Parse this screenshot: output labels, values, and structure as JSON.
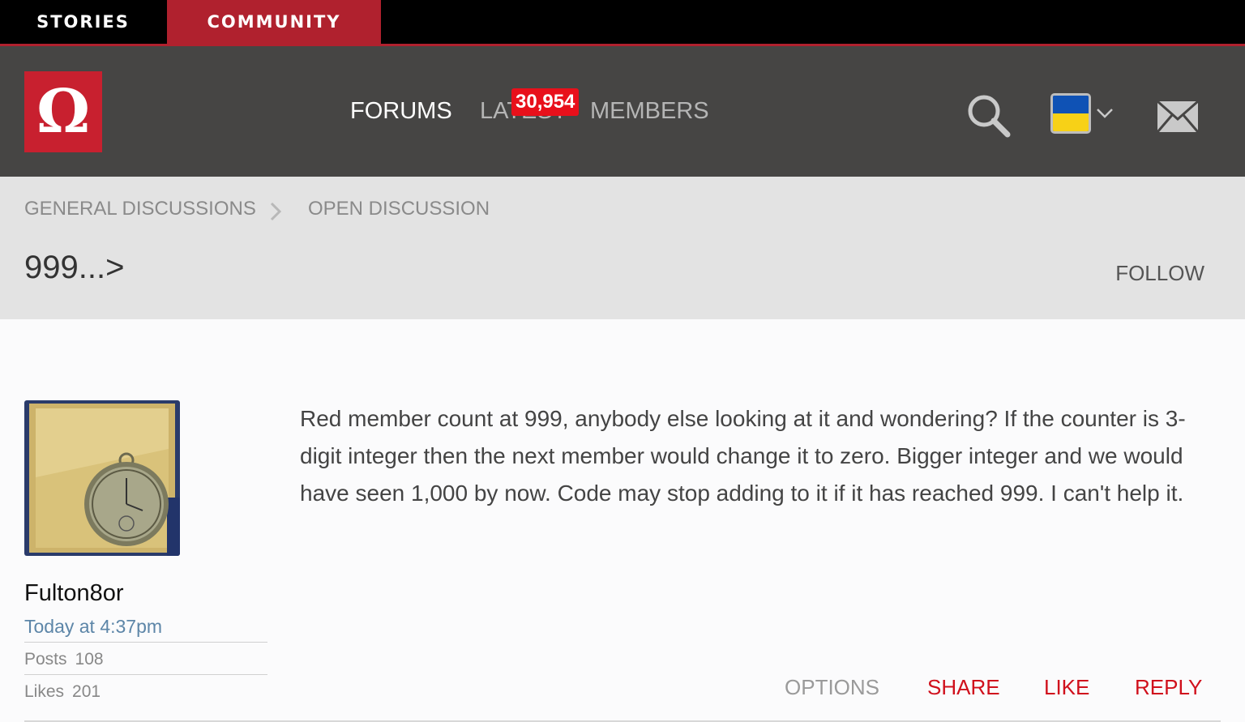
{
  "top_tabs": {
    "stories": "STORIES",
    "community": "COMMUNITY"
  },
  "header": {
    "logo_glyph": "Ω",
    "nav": {
      "forums": "FORUMS",
      "latest": "LATEST",
      "members": "MEMBERS"
    },
    "badge": "30,954",
    "icons": [
      "search-icon",
      "flag-icon",
      "chevron-down-icon",
      "mail-icon"
    ],
    "flag_colors": {
      "top": "#0f52b5",
      "bottom": "#f7d117"
    }
  },
  "breadcrumb": {
    "items": [
      "GENERAL DISCUSSIONS",
      "OPEN DISCUSSION"
    ]
  },
  "thread": {
    "title": "999...>",
    "follow_label": "FOLLOW"
  },
  "post": {
    "author": "Fulton8or",
    "time": "Today at 4:37pm",
    "posts_label": "Posts",
    "posts_count": "108",
    "likes_label": "Likes",
    "likes_count": "201",
    "body": "Red member count at 999, anybody else looking at it and wondering? If the counter is 3-digit integer then the next member would change it to zero. Bigger integer and we would have seen 1,000 by now. Code may stop adding to it if it has reached 999. I can't help it.",
    "actions": {
      "options": "OPTIONS",
      "share": "SHARE",
      "like": "LIKE",
      "reply": "REPLY"
    }
  },
  "colors": {
    "brand_red": "#b0212e",
    "header_bg": "#464544",
    "link_blue": "#5d86a8",
    "action_red": "#d0101c"
  }
}
